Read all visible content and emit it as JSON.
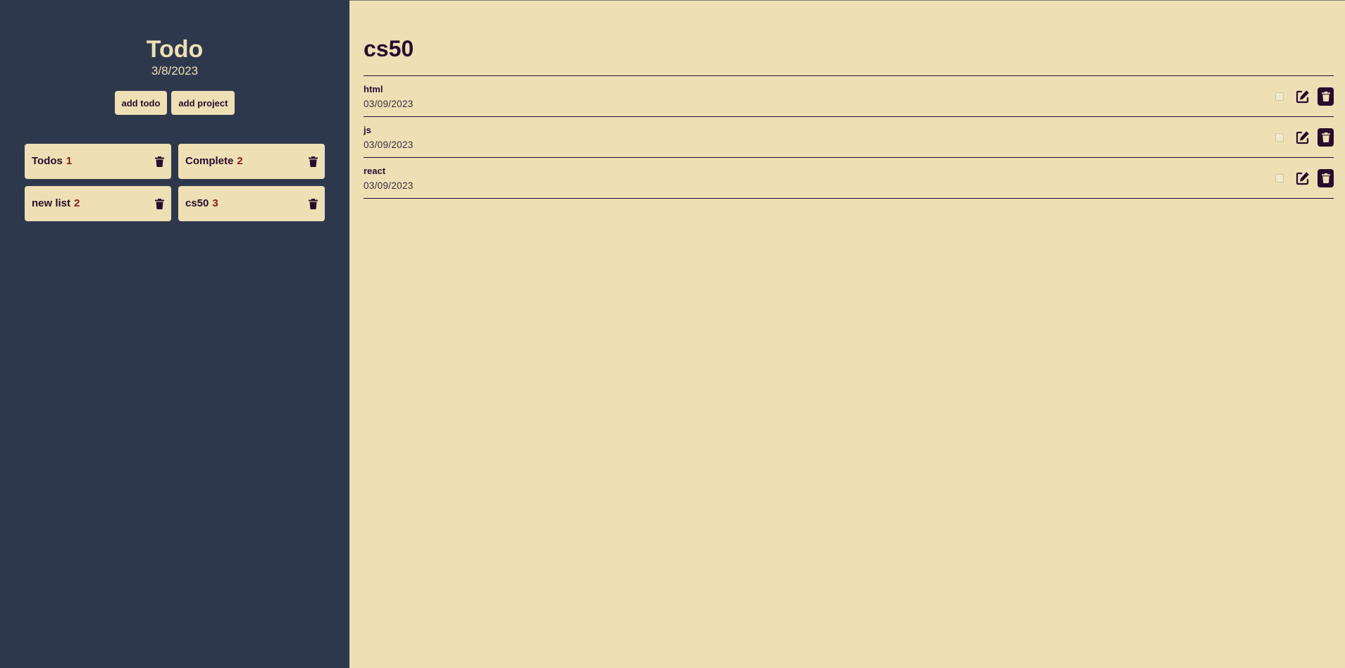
{
  "sidebar": {
    "title": "Todo",
    "date": "3/8/2023",
    "add_todo_label": "add todo",
    "add_project_label": "add project",
    "projects": [
      {
        "label": "Todos",
        "count": "1"
      },
      {
        "label": "Complete",
        "count": "2"
      },
      {
        "label": "new list",
        "count": "2"
      },
      {
        "label": "cs50",
        "count": "3"
      }
    ]
  },
  "main": {
    "title": "cs50",
    "todos": [
      {
        "title": "html",
        "date": "03/09/2023"
      },
      {
        "title": "js",
        "date": "03/09/2023"
      },
      {
        "title": "react",
        "date": "03/09/2023"
      }
    ]
  },
  "icons": {
    "project_delete": "trash-icon",
    "todo_edit": "pen-to-square-icon",
    "todo_delete": "trash-icon"
  },
  "colors": {
    "sidebar_bg": "#2E384D",
    "main_bg": "#EEE0B4",
    "text_dark": "#2A0A2E",
    "count_accent": "#8B1A1A"
  }
}
